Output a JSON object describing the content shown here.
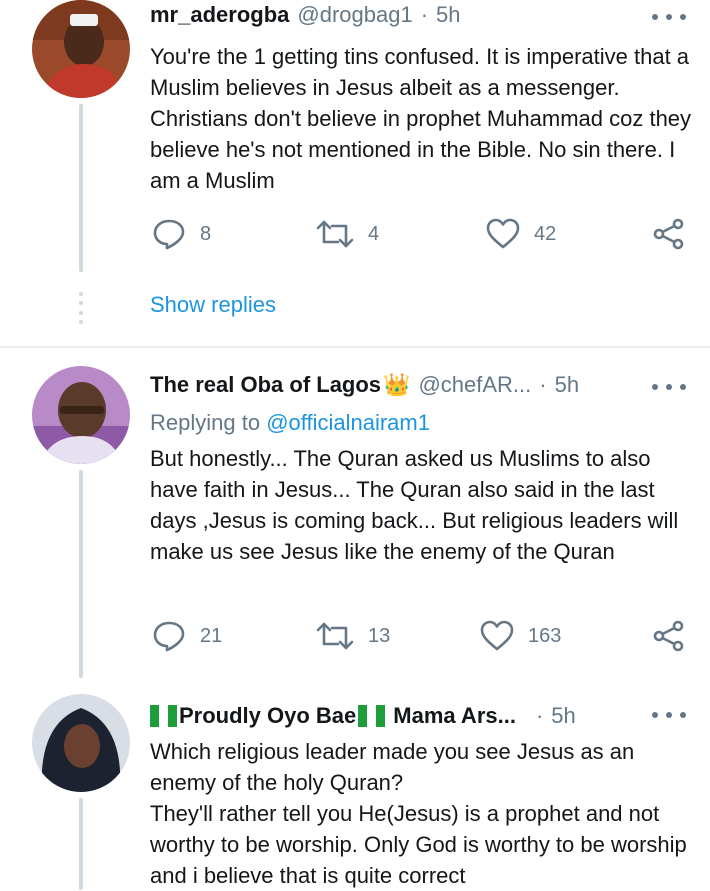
{
  "tweets": [
    {
      "display_name": "mr_aderogba",
      "handle": "@drogbag1",
      "separator": "·",
      "time": "5h",
      "text": "You're the 1 getting tins confused. It is imperative that a Muslim believes in Jesus albeit as a messenger. Christians don't believe in prophet Muhammad coz they believe he's not mentioned in the Bible. No sin there. I am a Muslim",
      "replies": "8",
      "retweets": "4",
      "likes": "42",
      "show_replies": "Show replies"
    },
    {
      "display_name": "The real Oba of Lagos",
      "name_emoji": "👑",
      "handle": "@chefAR...",
      "separator": "·",
      "time": "5h",
      "replying_prefix": "Replying to",
      "replying_handle": "@officialnairam1",
      "text": "But honestly... The Quran asked us Muslims to also have faith in Jesus... The Quran also said in the last days ,Jesus is coming back... But religious leaders will make us see Jesus like the enemy of the Quran",
      "replies": "21",
      "retweets": "13",
      "likes": "163"
    },
    {
      "display_name_part1": "Proudly Oyo Bae",
      "display_name_part2": "Mama Ars...",
      "separator": "·",
      "time": "5h",
      "text": "Which religious leader made you see Jesus as an enemy of the holy Quran?\nThey'll rather tell you He(Jesus) is a prophet and not worthy to be worship. Only God is worthy to be worship and i believe that is quite correct"
    }
  ],
  "colors": {
    "link": "#1b95e0",
    "muted": "#657786",
    "thread_line": "#cfd9de",
    "nigeria_green": "#1e9e3a"
  }
}
